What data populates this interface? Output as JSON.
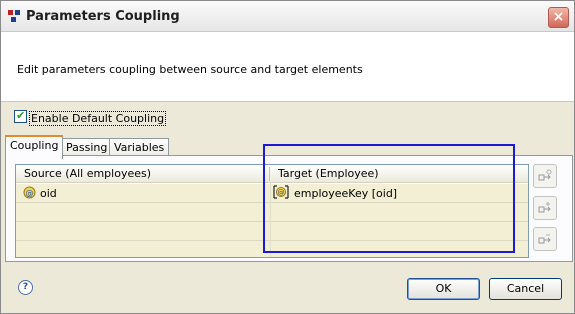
{
  "window": {
    "title": "Parameters Coupling",
    "close_label": "×"
  },
  "banner": {
    "message": "Edit parameters coupling between source and target elements"
  },
  "enable_default_coupling": {
    "label": "Enable Default Coupling",
    "checked": true
  },
  "tabs": [
    {
      "label": "Coupling",
      "active": true
    },
    {
      "label": "Passing",
      "active": false
    },
    {
      "label": "Variables",
      "active": false
    }
  ],
  "table": {
    "columns": [
      "Source (All employees)",
      "Target (Employee)"
    ],
    "rows": [
      {
        "source": "oid",
        "target": "employeeKey [oid]"
      }
    ]
  },
  "side_buttons": [
    {
      "icon": "couple-icon"
    },
    {
      "icon": "add-coupling-icon"
    },
    {
      "icon": "remove-coupling-icon"
    }
  ],
  "footer": {
    "help_label": "?",
    "ok_label": "OK",
    "cancel_label": "Cancel"
  }
}
